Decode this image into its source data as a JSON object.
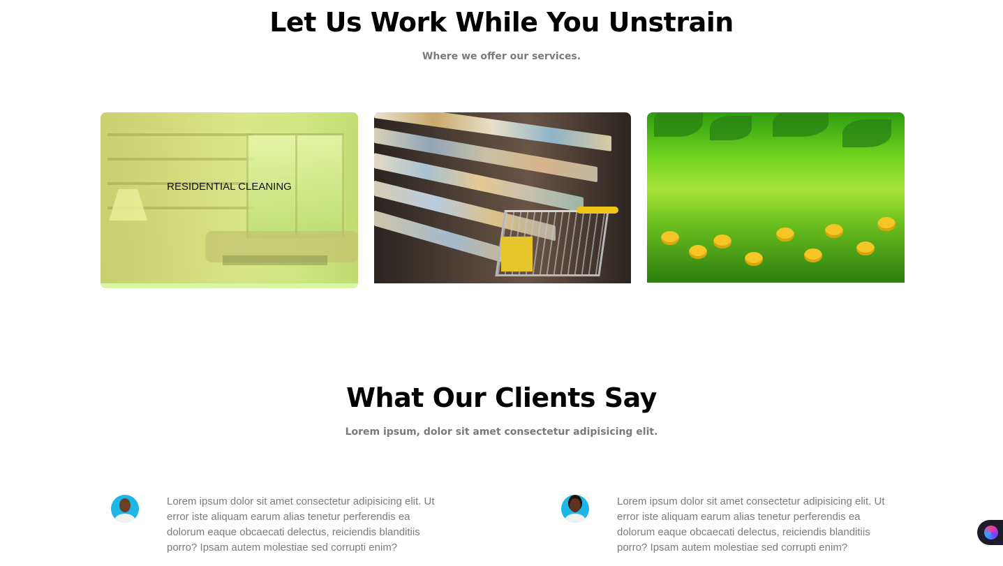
{
  "services": {
    "title": "Let Us Work While You Unstrain",
    "subtitle": "Where we offer our services.",
    "cards": [
      {
        "label": "RESIDENTIAL CLEANING",
        "image": "living-room"
      },
      {
        "label": "",
        "image": "grocery-store"
      },
      {
        "label": "",
        "image": "garden"
      }
    ]
  },
  "clients": {
    "title": "What Our Clients Say",
    "subtitle": "Lorem ipsum, dolor sit amet consectetur adipisicing elit.",
    "testimonials": [
      {
        "text": "Lorem ipsum dolor sit amet consectetur adipisicing elit. Ut error iste aliquam earum alias tenetur perferendis ea dolorum eaque obcaecati delectus, reiciendis blanditiis porro? Ipsam autem molestiae sed corrupti enim?"
      },
      {
        "text": "Lorem ipsum dolor sit amet consectetur adipisicing elit. Ut error iste aliquam earum alias tenetur perferendis ea dolorum eaque obcaecati delectus, reiciendis blanditiis porro? Ipsam autem molestiae sed corrupti enim?"
      }
    ]
  },
  "colors": {
    "accent_bar": "#d7f7a5",
    "avatar_bg": "#1eb6e6",
    "subtitle_gray": "#7a7a7a"
  },
  "widget": {
    "icon": "brain-icon"
  }
}
